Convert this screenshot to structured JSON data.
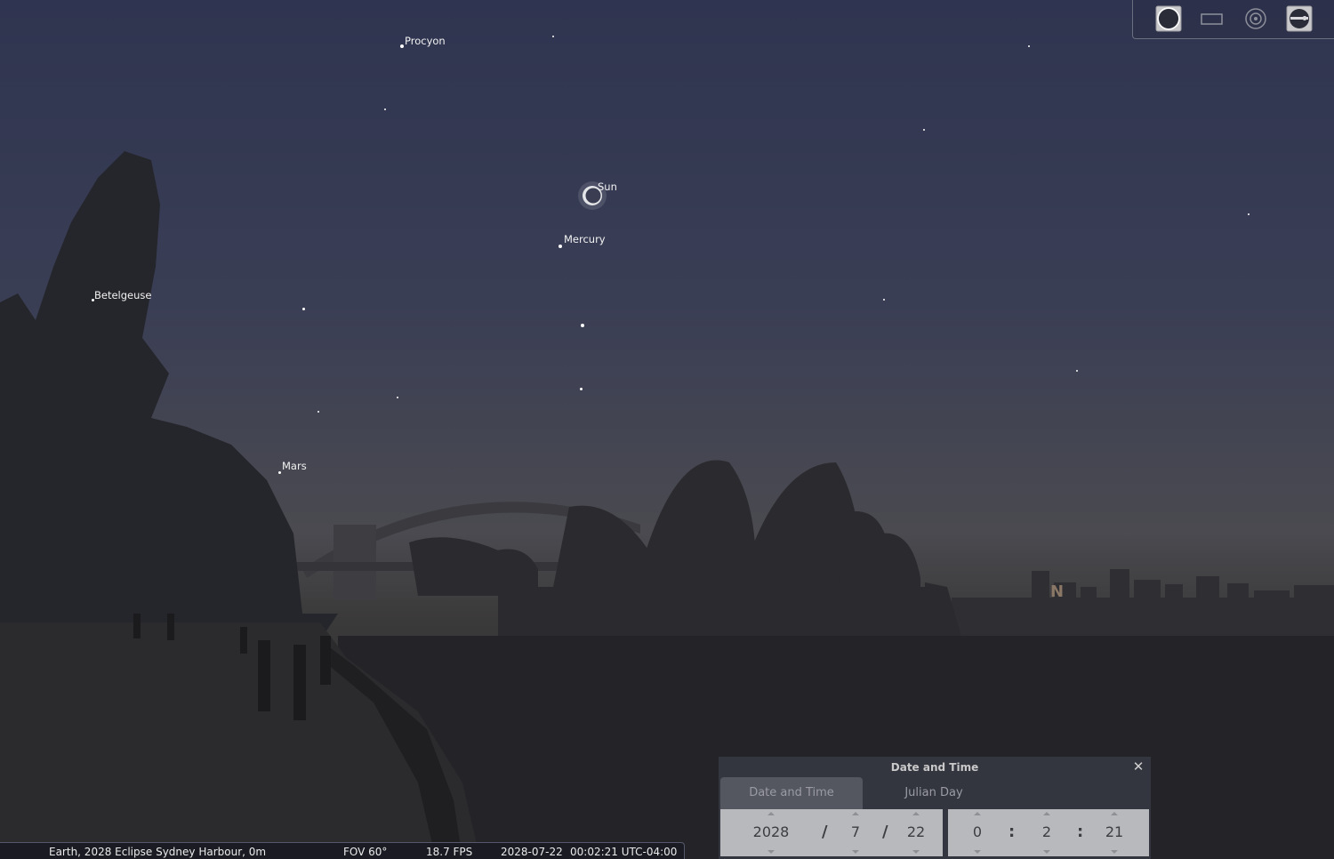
{
  "app": "Stellarium",
  "sky": {
    "labels": {
      "procyon": "Procyon",
      "sun": "Sun",
      "mercury": "Mercury",
      "betelgeuse": "Betelgeuse",
      "mars": "Mars",
      "north": "N"
    }
  },
  "toolbar": {
    "icons": [
      "eclipse-icon",
      "rectangle-icon",
      "target-icon",
      "horizon-icon"
    ]
  },
  "status": {
    "location": "Earth, 2028 Eclipse Sydney Harbour, 0m",
    "fov": "FOV 60°",
    "fps": "18.7 FPS",
    "date": "2028-07-22",
    "time": "00:02:21 UTC-04:00"
  },
  "date_time_dialog": {
    "title": "Date and Time",
    "tabs": [
      "Date and Time",
      "Julian Day"
    ],
    "date": {
      "year": "2028",
      "month": "7",
      "day": "22",
      "separator": "/"
    },
    "time": {
      "hour": "0",
      "minute": "2",
      "second": "21",
      "separator": ":"
    }
  },
  "colors": {
    "sky_top": "#2f3450",
    "horizon": "#4a4a50",
    "silhouette": "#26262a",
    "dialog_panel": "#b8b9bd"
  }
}
